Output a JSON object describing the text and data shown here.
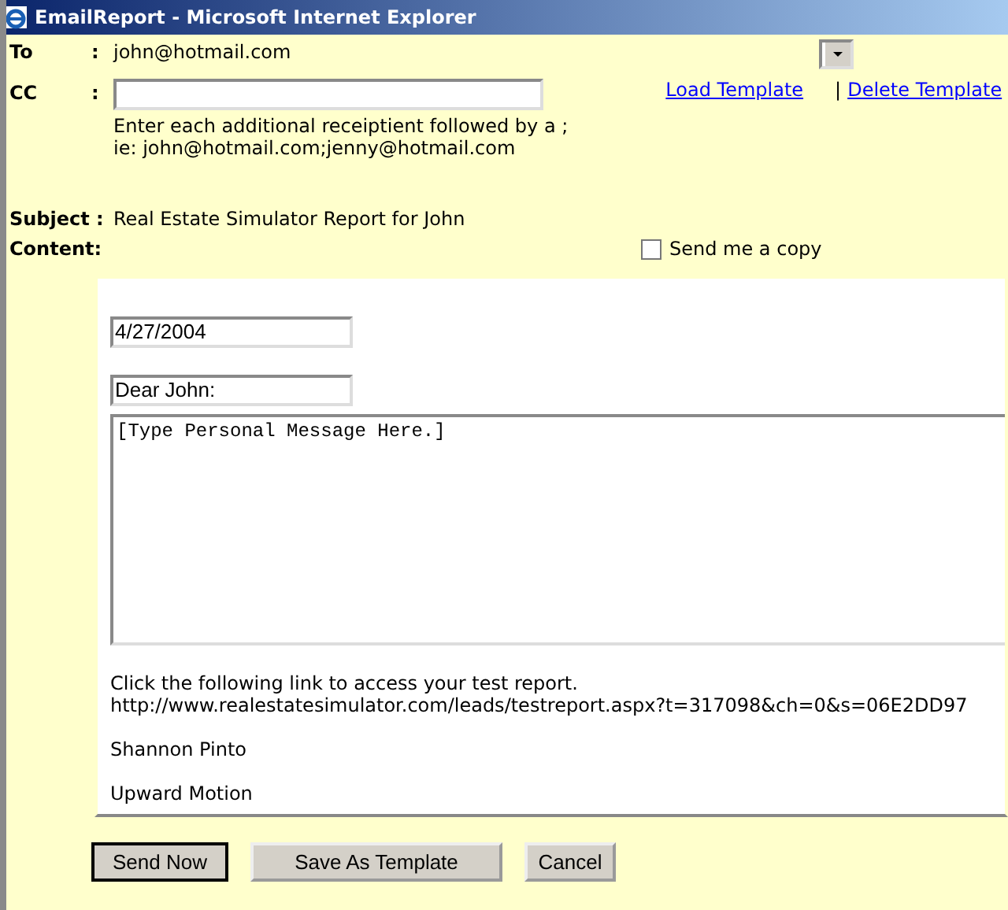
{
  "window": {
    "title": "EmailReport - Microsoft Internet Explorer"
  },
  "to": {
    "label": "To",
    "separator": ":",
    "value": "john@hotmail.com"
  },
  "cc": {
    "label": "CC",
    "separator": ":",
    "hint_lines": [
      "Enter each additional receiptient followed by a ;",
      "ie: john@hotmail.com;jenny@hotmail.com"
    ]
  },
  "template_links": [
    {
      "label": "Load Template"
    },
    {
      "label": "Delete Template",
      "divider": "|"
    }
  ],
  "subject": {
    "label": "Subject :",
    "value": "Real Estate Simulator Report for John"
  },
  "content": {
    "label": "Content:"
  },
  "send_copy": {
    "label": "Send me a copy",
    "checked": false
  },
  "letter": {
    "date": "4/27/2004",
    "greeting": "Dear John:",
    "message": "[Type Personal Message Here.]",
    "body_lines": [
      "Click the following link to access your test report.",
      "http://www.realestatesimulator.com/leads/testreport.aspx?t=317098&ch=0&s=06E2DD97"
    ],
    "signature": [
      "Shannon Pinto",
      "Upward Motion"
    ]
  },
  "buttons": [
    {
      "label": "Send Now",
      "default": true
    },
    {
      "label": "Save As Template",
      "default": false
    },
    {
      "label": "Cancel",
      "default": false
    }
  ]
}
